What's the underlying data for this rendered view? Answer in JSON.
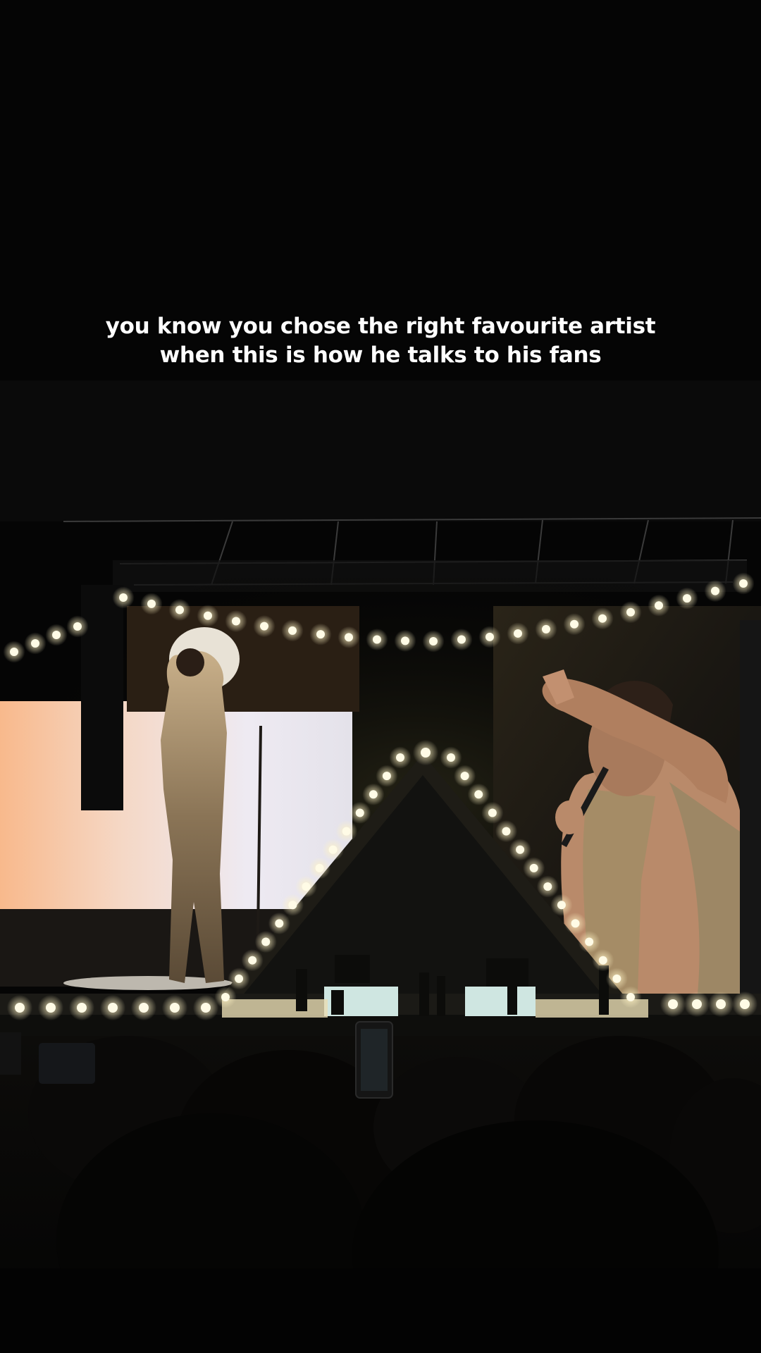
{
  "caption": {
    "line1": "you know you chose the right favourite artist",
    "line2": "when this is how he talks to his fans"
  },
  "scene": {
    "description_icon": "concert-stage-photo",
    "colors": {
      "background": "#050505",
      "stage_light": "#fff6cf",
      "screen_warm": "#f4c9a8",
      "screen_white": "#ecebf0"
    }
  }
}
